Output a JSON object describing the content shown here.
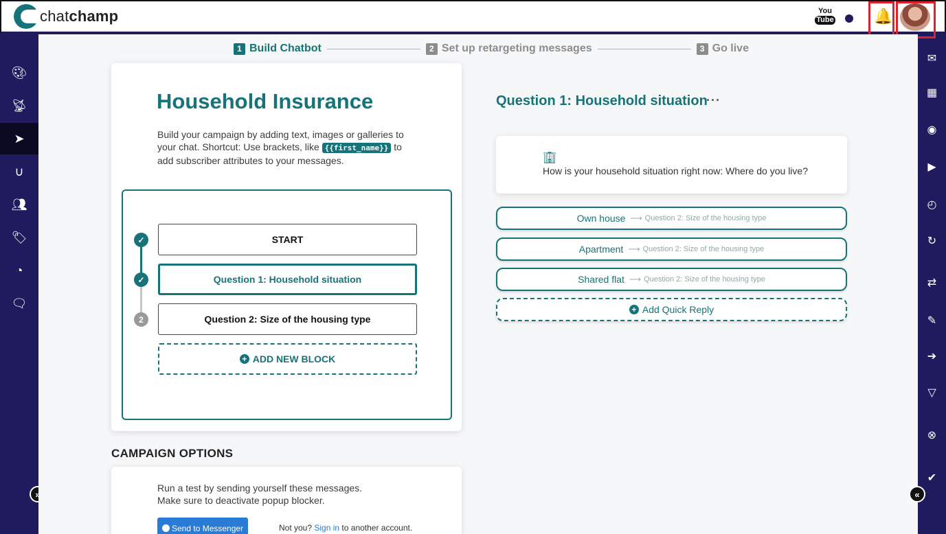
{
  "brand": {
    "logo_prefix": "chat",
    "logo_suffix": "champ"
  },
  "header": {
    "youtube_top": "You",
    "youtube_bottom": "Tube"
  },
  "steps": [
    {
      "num": "1",
      "label": "Build Chatbot"
    },
    {
      "num": "2",
      "label": "Set up retargeting messages"
    },
    {
      "num": "3",
      "label": "Go live"
    }
  ],
  "campaign": {
    "title": "Household Insurance",
    "desc_a": "Build your campaign by adding text, images or galleries to your chat. Shortcut: Use brackets, like ",
    "desc_code": "{{first_name}}",
    "desc_b": " to add subscriber attributes to your messages.",
    "blocks": [
      {
        "label": "START"
      },
      {
        "label": "Question 1: Household situation"
      },
      {
        "label": "Question 2: Size of the housing type"
      }
    ],
    "step_badge": "2",
    "add_block": "ADD NEW BLOCK"
  },
  "question": {
    "title": "Question 1: Household situation",
    "more": "···",
    "message": "How is your household situation right now: Where do you live?",
    "replies": [
      {
        "label": "Own house",
        "target": "Question 2: Size of the housing type"
      },
      {
        "label": "Apartment",
        "target": "Question 2: Size of the housing type"
      },
      {
        "label": "Shared flat",
        "target": "Question 2: Size of the housing type"
      }
    ],
    "add_reply": "Add Quick Reply"
  },
  "options": {
    "heading": "CAMPAIGN OPTIONS",
    "test_line1": "Run a test by sending yourself these messages.",
    "test_line2": "Make sure to deactivate popup blocker.",
    "send_button": "Send to Messenger",
    "not_you": "Not you?",
    "sign_in": "Sign in",
    "another": "to another account."
  },
  "icons": {
    "accent": "#16737a",
    "sidebar": "#1f1b5e",
    "highlight": "#e0202a"
  }
}
